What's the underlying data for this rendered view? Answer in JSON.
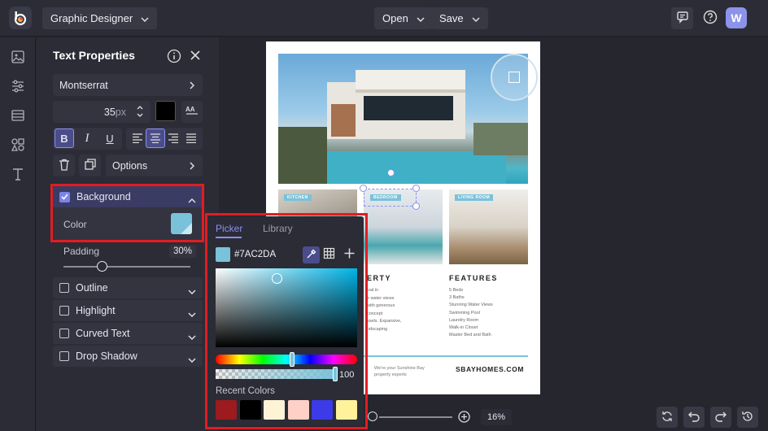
{
  "topbar": {
    "app_mode": "Graphic Designer",
    "open_label": "Open",
    "save_label": "Save",
    "avatar_initial": "W"
  },
  "panel": {
    "title": "Text Properties",
    "font_name": "Montserrat",
    "font_size": "35",
    "font_size_unit": "px",
    "text_color": "#000000",
    "bold_label": "B",
    "italic_label": "I",
    "underline_label": "U",
    "options_label": "Options",
    "background": {
      "label": "Background",
      "checked": true,
      "color_label": "Color",
      "color_value": "#7AC2DA",
      "padding_label": "Padding",
      "padding_value": "30%",
      "padding_fraction": 0.3
    },
    "sections": [
      {
        "label": "Outline",
        "checked": false
      },
      {
        "label": "Highlight",
        "checked": false
      },
      {
        "label": "Curved Text",
        "checked": false
      },
      {
        "label": "Drop Shadow",
        "checked": false
      }
    ]
  },
  "color_picker": {
    "tabs": [
      "Picker",
      "Library"
    ],
    "active_tab": "Picker",
    "hex_value": "#7AC2DA",
    "opacity_value": "100",
    "recent_label": "Recent Colors",
    "recent_colors": [
      "#9b1b1e",
      "#000000",
      "#fff3d6",
      "#ffd0c6",
      "#3d3be8",
      "#fff29a"
    ]
  },
  "canvas": {
    "zoom_label": "16%",
    "labels": [
      "KITCHEN",
      "BEDROOM",
      "LIVING ROOM"
    ],
    "property_heading": "ERTY",
    "property_lines": [
      "ival in",
      "e water views",
      "with generous",
      "concept",
      "ssels. Expansive,",
      "ndscaping"
    ],
    "features_heading": "FEATURES",
    "features_lines": [
      "5 Beds",
      "3 Baths",
      "Stunning Water Views",
      "Swimming Pool",
      "Laundry Room",
      "Walk-in Closet",
      "Master Bed and Bath"
    ],
    "footer_left": "We're your Sunshine Bay property experts",
    "footer_right": "SBAYHOMES.COM"
  },
  "colors": {
    "accent": "#6c63d9",
    "highlight_red": "#e11d21",
    "selected_color": "#7AC2DA"
  }
}
